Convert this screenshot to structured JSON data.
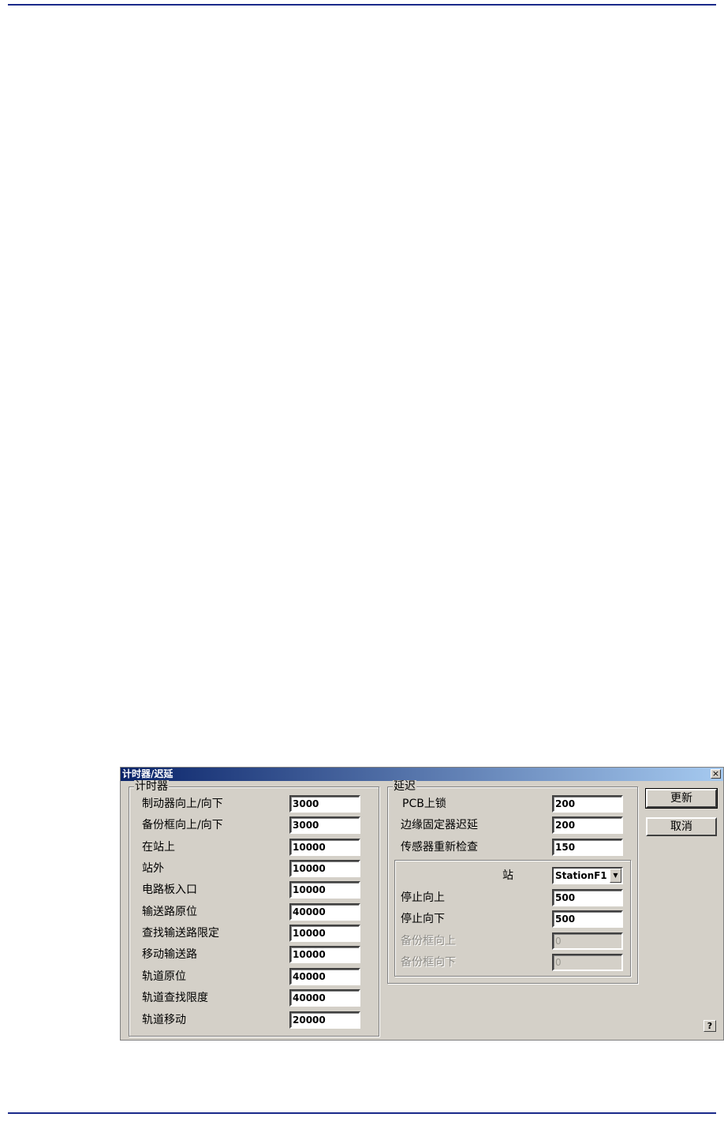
{
  "dialog": {
    "title": "计时器/迟延",
    "close_glyph": "×",
    "timers": {
      "label": "计时器",
      "rows": [
        {
          "label": "制动器向上/向下",
          "value": "3000"
        },
        {
          "label": "备份框向上/向下",
          "value": "3000"
        },
        {
          "label": "在站上",
          "value": "10000"
        },
        {
          "label": "站外",
          "value": "10000"
        },
        {
          "label": "电路板入口",
          "value": "10000"
        },
        {
          "label": "输送路原位",
          "value": "40000"
        },
        {
          "label": "查找输送路限定",
          "value": "10000"
        },
        {
          "label": "移动输送路",
          "value": "10000"
        },
        {
          "label": "轨道原位",
          "value": "40000"
        },
        {
          "label": "轨道查找限度",
          "value": "40000"
        },
        {
          "label": "轨道移动",
          "value": "20000"
        }
      ]
    },
    "delays": {
      "label": "延迟",
      "rows": [
        {
          "label": "PCB上锁",
          "value": "200"
        },
        {
          "label": "边缘固定器迟延",
          "value": "200"
        },
        {
          "label": "传感器重新检查",
          "value": "150"
        }
      ],
      "station": {
        "label": "站",
        "selected": "StationF1",
        "arrow_glyph": "▼",
        "rows": [
          {
            "label": "停止向上",
            "value": "500",
            "disabled": false
          },
          {
            "label": "停止向下",
            "value": "500",
            "disabled": false
          },
          {
            "label": "备份框向上",
            "value": "0",
            "disabled": true
          },
          {
            "label": "备份框向下",
            "value": "0",
            "disabled": true
          }
        ]
      }
    },
    "buttons": {
      "update": "更新",
      "cancel": "取消",
      "help": "?"
    }
  }
}
